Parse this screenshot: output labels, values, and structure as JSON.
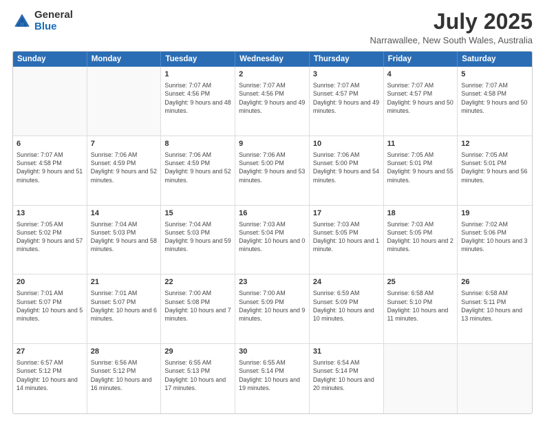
{
  "header": {
    "logo_general": "General",
    "logo_blue": "Blue",
    "month_year": "July 2025",
    "location": "Narrawallee, New South Wales, Australia"
  },
  "weekdays": [
    "Sunday",
    "Monday",
    "Tuesday",
    "Wednesday",
    "Thursday",
    "Friday",
    "Saturday"
  ],
  "weeks": [
    [
      {
        "day": "",
        "info": ""
      },
      {
        "day": "",
        "info": ""
      },
      {
        "day": "1",
        "info": "Sunrise: 7:07 AM\nSunset: 4:56 PM\nDaylight: 9 hours\nand 48 minutes."
      },
      {
        "day": "2",
        "info": "Sunrise: 7:07 AM\nSunset: 4:56 PM\nDaylight: 9 hours\nand 49 minutes."
      },
      {
        "day": "3",
        "info": "Sunrise: 7:07 AM\nSunset: 4:57 PM\nDaylight: 9 hours\nand 49 minutes."
      },
      {
        "day": "4",
        "info": "Sunrise: 7:07 AM\nSunset: 4:57 PM\nDaylight: 9 hours\nand 50 minutes."
      },
      {
        "day": "5",
        "info": "Sunrise: 7:07 AM\nSunset: 4:58 PM\nDaylight: 9 hours\nand 50 minutes."
      }
    ],
    [
      {
        "day": "6",
        "info": "Sunrise: 7:07 AM\nSunset: 4:58 PM\nDaylight: 9 hours\nand 51 minutes."
      },
      {
        "day": "7",
        "info": "Sunrise: 7:06 AM\nSunset: 4:59 PM\nDaylight: 9 hours\nand 52 minutes."
      },
      {
        "day": "8",
        "info": "Sunrise: 7:06 AM\nSunset: 4:59 PM\nDaylight: 9 hours\nand 52 minutes."
      },
      {
        "day": "9",
        "info": "Sunrise: 7:06 AM\nSunset: 5:00 PM\nDaylight: 9 hours\nand 53 minutes."
      },
      {
        "day": "10",
        "info": "Sunrise: 7:06 AM\nSunset: 5:00 PM\nDaylight: 9 hours\nand 54 minutes."
      },
      {
        "day": "11",
        "info": "Sunrise: 7:05 AM\nSunset: 5:01 PM\nDaylight: 9 hours\nand 55 minutes."
      },
      {
        "day": "12",
        "info": "Sunrise: 7:05 AM\nSunset: 5:01 PM\nDaylight: 9 hours\nand 56 minutes."
      }
    ],
    [
      {
        "day": "13",
        "info": "Sunrise: 7:05 AM\nSunset: 5:02 PM\nDaylight: 9 hours\nand 57 minutes."
      },
      {
        "day": "14",
        "info": "Sunrise: 7:04 AM\nSunset: 5:03 PM\nDaylight: 9 hours\nand 58 minutes."
      },
      {
        "day": "15",
        "info": "Sunrise: 7:04 AM\nSunset: 5:03 PM\nDaylight: 9 hours\nand 59 minutes."
      },
      {
        "day": "16",
        "info": "Sunrise: 7:03 AM\nSunset: 5:04 PM\nDaylight: 10 hours\nand 0 minutes."
      },
      {
        "day": "17",
        "info": "Sunrise: 7:03 AM\nSunset: 5:05 PM\nDaylight: 10 hours\nand 1 minute."
      },
      {
        "day": "18",
        "info": "Sunrise: 7:03 AM\nSunset: 5:05 PM\nDaylight: 10 hours\nand 2 minutes."
      },
      {
        "day": "19",
        "info": "Sunrise: 7:02 AM\nSunset: 5:06 PM\nDaylight: 10 hours\nand 3 minutes."
      }
    ],
    [
      {
        "day": "20",
        "info": "Sunrise: 7:01 AM\nSunset: 5:07 PM\nDaylight: 10 hours\nand 5 minutes."
      },
      {
        "day": "21",
        "info": "Sunrise: 7:01 AM\nSunset: 5:07 PM\nDaylight: 10 hours\nand 6 minutes."
      },
      {
        "day": "22",
        "info": "Sunrise: 7:00 AM\nSunset: 5:08 PM\nDaylight: 10 hours\nand 7 minutes."
      },
      {
        "day": "23",
        "info": "Sunrise: 7:00 AM\nSunset: 5:09 PM\nDaylight: 10 hours\nand 9 minutes."
      },
      {
        "day": "24",
        "info": "Sunrise: 6:59 AM\nSunset: 5:09 PM\nDaylight: 10 hours\nand 10 minutes."
      },
      {
        "day": "25",
        "info": "Sunrise: 6:58 AM\nSunset: 5:10 PM\nDaylight: 10 hours\nand 11 minutes."
      },
      {
        "day": "26",
        "info": "Sunrise: 6:58 AM\nSunset: 5:11 PM\nDaylight: 10 hours\nand 13 minutes."
      }
    ],
    [
      {
        "day": "27",
        "info": "Sunrise: 6:57 AM\nSunset: 5:12 PM\nDaylight: 10 hours\nand 14 minutes."
      },
      {
        "day": "28",
        "info": "Sunrise: 6:56 AM\nSunset: 5:12 PM\nDaylight: 10 hours\nand 16 minutes."
      },
      {
        "day": "29",
        "info": "Sunrise: 6:55 AM\nSunset: 5:13 PM\nDaylight: 10 hours\nand 17 minutes."
      },
      {
        "day": "30",
        "info": "Sunrise: 6:55 AM\nSunset: 5:14 PM\nDaylight: 10 hours\nand 19 minutes."
      },
      {
        "day": "31",
        "info": "Sunrise: 6:54 AM\nSunset: 5:14 PM\nDaylight: 10 hours\nand 20 minutes."
      },
      {
        "day": "",
        "info": ""
      },
      {
        "day": "",
        "info": ""
      }
    ]
  ]
}
